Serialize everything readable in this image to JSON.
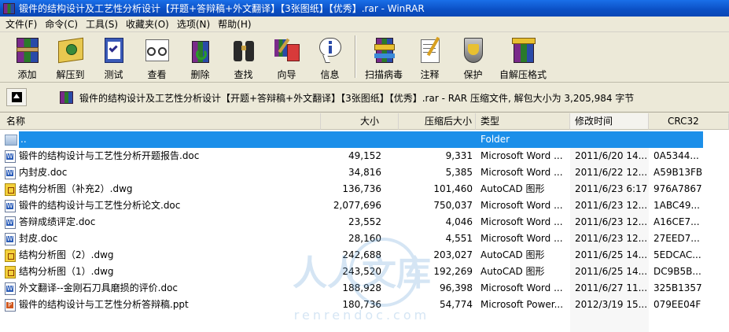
{
  "window": {
    "title": "锻件的结构设计及工艺性分析设计【开题+答辩稿+外文翻译】【3张图纸】【优秀】.rar - WinRAR"
  },
  "menu": [
    "文件(F)",
    "命令(C)",
    "工具(S)",
    "收藏夹(O)",
    "选项(N)",
    "帮助(H)"
  ],
  "toolbar": {
    "group1": [
      {
        "label": "添加",
        "icon": "archive-add-icon"
      },
      {
        "label": "解压到",
        "icon": "extract-folder-icon"
      },
      {
        "label": "测试",
        "icon": "test-clipboard-icon"
      },
      {
        "label": "查看",
        "icon": "view-glasses-icon"
      },
      {
        "label": "删除",
        "icon": "delete-recycle-icon"
      },
      {
        "label": "查找",
        "icon": "find-binoculars-icon"
      },
      {
        "label": "向导",
        "icon": "wizard-icon"
      },
      {
        "label": "信息",
        "icon": "info-icon"
      }
    ],
    "group2": [
      {
        "label": "扫描病毒",
        "icon": "virus-scan-icon"
      },
      {
        "label": "注释",
        "icon": "comment-icon"
      },
      {
        "label": "保护",
        "icon": "protect-shield-icon"
      },
      {
        "label": "自解压格式",
        "icon": "sfx-icon"
      }
    ]
  },
  "address": {
    "text": "锻件的结构设计及工艺性分析设计【开题+答辩稿+外文翻译】【3张图纸】【优秀】.rar - RAR 压缩文件, 解包大小为 3,205,984 字节"
  },
  "columns": {
    "name": "名称",
    "size": "大小",
    "packed": "压缩后大小",
    "type": "类型",
    "modified": "修改时间",
    "crc": "CRC32"
  },
  "files": [
    {
      "name": "..",
      "size": "",
      "packed": "",
      "type": "Folder",
      "modified": "",
      "crc": "",
      "kind": "folder",
      "selected": true
    },
    {
      "name": "锻件的结构设计与工艺性分析开题报告.doc",
      "size": "49,152",
      "packed": "9,331",
      "type": "Microsoft Word ...",
      "modified": "2011/6/20 14...",
      "crc": "0A5344...",
      "kind": "doc"
    },
    {
      "name": "内封皮.doc",
      "size": "34,816",
      "packed": "5,385",
      "type": "Microsoft Word ...",
      "modified": "2011/6/22 12...",
      "crc": "A59B13FB",
      "kind": "doc"
    },
    {
      "name": "结构分析图（补充2）.dwg",
      "size": "136,736",
      "packed": "101,460",
      "type": "AutoCAD 图形",
      "modified": "2011/6/23 6:17",
      "crc": "976A7867",
      "kind": "dwg"
    },
    {
      "name": "锻件的结构设计与工艺性分析论文.doc",
      "size": "2,077,696",
      "packed": "750,037",
      "type": "Microsoft Word ...",
      "modified": "2011/6/23 12...",
      "crc": "1ABC49...",
      "kind": "doc"
    },
    {
      "name": "答辩成绩评定.doc",
      "size": "23,552",
      "packed": "4,046",
      "type": "Microsoft Word ...",
      "modified": "2011/6/23 12...",
      "crc": "A16CE7...",
      "kind": "doc"
    },
    {
      "name": "封皮.doc",
      "size": "28,160",
      "packed": "4,551",
      "type": "Microsoft Word ...",
      "modified": "2011/6/23 12...",
      "crc": "27EED7...",
      "kind": "doc"
    },
    {
      "name": "结构分析图（2）.dwg",
      "size": "242,688",
      "packed": "203,027",
      "type": "AutoCAD 图形",
      "modified": "2011/6/25 14...",
      "crc": "5EDCAC...",
      "kind": "dwg"
    },
    {
      "name": "结构分析图（1）.dwg",
      "size": "243,520",
      "packed": "192,269",
      "type": "AutoCAD 图形",
      "modified": "2011/6/25 14...",
      "crc": "DC9B5B...",
      "kind": "dwg"
    },
    {
      "name": "外文翻译--金刚石刀具磨损的评价.doc",
      "size": "188,928",
      "packed": "96,398",
      "type": "Microsoft Word ...",
      "modified": "2011/6/27 11...",
      "crc": "325B1357",
      "kind": "doc"
    },
    {
      "name": "锻件的结构设计与工艺性分析答辩稿.ppt",
      "size": "180,736",
      "packed": "54,774",
      "type": "Microsoft Power...",
      "modified": "2012/3/19 15...",
      "crc": "079EE04F",
      "kind": "ppt"
    }
  ],
  "watermark": {
    "text": "人人文库",
    "url": "renrendoc.com"
  }
}
